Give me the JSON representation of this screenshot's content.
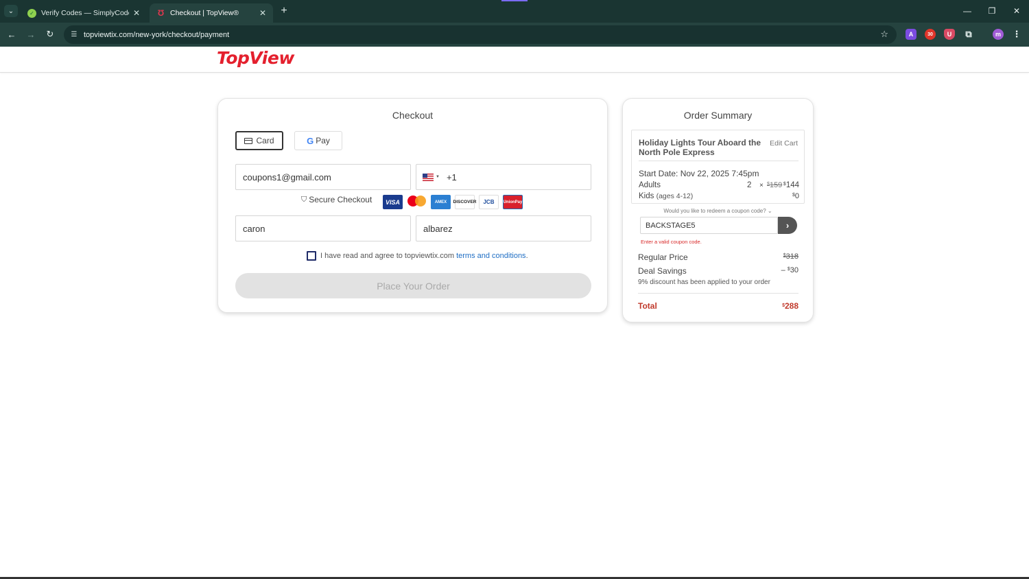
{
  "browser": {
    "tabs": [
      {
        "title": "Verify Codes — SimplyCodes",
        "active": false
      },
      {
        "title": "Checkout | TopView®",
        "active": true
      }
    ],
    "url": "topviewtix.com/new-york/checkout/payment",
    "extensions": [
      {
        "name": "a-ext",
        "label": "A",
        "color": "#7b4ce0"
      },
      {
        "name": "badge-ext",
        "label": "30",
        "color": "#e0352a"
      },
      {
        "name": "shield-ext",
        "label": "U",
        "color": "#d94a64"
      }
    ],
    "profile_initial": "m"
  },
  "site": {
    "logo": "TopView"
  },
  "checkout": {
    "title": "Checkout",
    "payment_methods": {
      "card_label": "Card",
      "gpay_g": "G",
      "gpay_label": "Pay"
    },
    "email": "coupons1@gmail.com",
    "phone_code": "+1",
    "secure_label": "Secure Checkout",
    "card_logos": [
      "VISA",
      "mastercard",
      "AMEX",
      "DISCOVER",
      "JCB",
      "UnionPay"
    ],
    "first_name": "caron",
    "last_name": "albarez",
    "agree_text": "I have read and agree to topviewtix.com",
    "agree_link": "terms and conditions",
    "agree_end": ".",
    "place_order": "Place Your Order"
  },
  "summary": {
    "title": "Order Summary",
    "tour_title": "Holiday Lights Tour Aboard the North Pole Express",
    "edit_cart": "Edit Cart",
    "start_date": "Start Date: Nov 22, 2025 7:45pm",
    "adults_label": "Adults",
    "adults_qty": "2",
    "times": "×",
    "adults_old_price": "159",
    "adults_new_price": "144",
    "kids_label": "Kids",
    "kids_sub": "(ages 4-12)",
    "kids_price": "0",
    "currency": "$",
    "coupon_question": "Would you like to redeem a coupon code?",
    "coupon_value": "BACKSTAGE5",
    "coupon_error": "Enter a valid coupon code.",
    "regular_price_label": "Regular Price",
    "regular_price": "318",
    "deal_savings_label": "Deal Savings",
    "deal_savings": "30",
    "discount_note": "9% discount has been applied to your order",
    "total_label": "Total",
    "total": "288"
  }
}
